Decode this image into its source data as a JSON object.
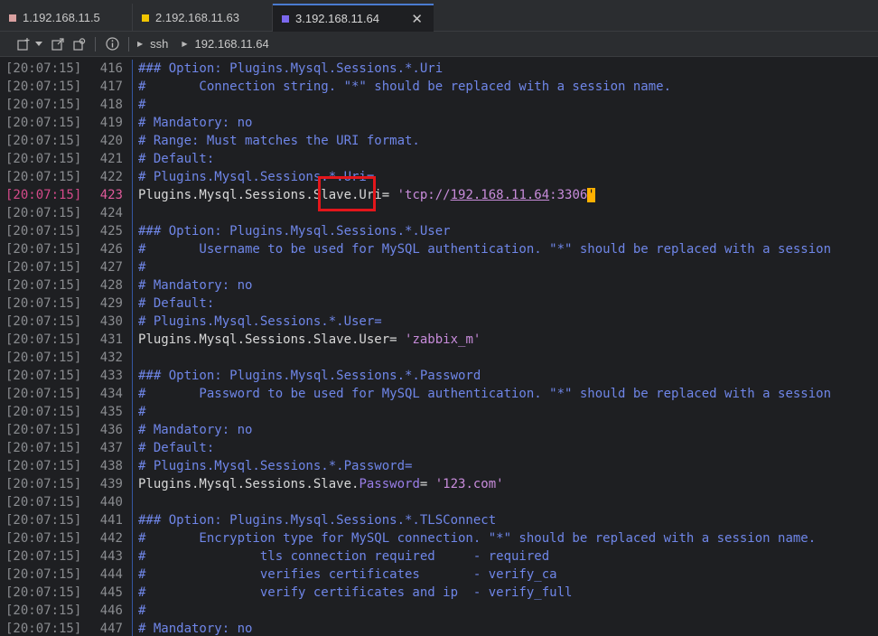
{
  "tabs": [
    {
      "label": "1.192.168.11.5",
      "color": "#d9a0a0"
    },
    {
      "label": "2.192.168.11.63",
      "color": "#f0c400"
    },
    {
      "label": "3.192.168.11.64",
      "color": "#7b68ee"
    }
  ],
  "close_glyph": "✕",
  "toolbar": {
    "breadcrumb": [
      "ssh",
      "192.168.11.64"
    ],
    "icons": [
      "new-tab-icon",
      "chevron-down-icon",
      "new-window-icon",
      "duplicate-icon",
      "info-icon"
    ]
  },
  "lines": [
    {
      "ts": "[20:07:15]",
      "n": "416",
      "t": "### Option: Plugins.Mysql.Sessions.*.Uri"
    },
    {
      "ts": "[20:07:15]",
      "n": "417",
      "t": "#       Connection string. \"*\" should be replaced with a session name."
    },
    {
      "ts": "[20:07:15]",
      "n": "418",
      "t": "#"
    },
    {
      "ts": "[20:07:15]",
      "n": "419",
      "t": "# Mandatory: no"
    },
    {
      "ts": "[20:07:15]",
      "n": "420",
      "t": "# Range: Must matches the URI format."
    },
    {
      "ts": "[20:07:15]",
      "n": "421",
      "t": "# Default:"
    },
    {
      "ts": "[20:07:15]",
      "n": "422",
      "t": "# Plugins.Mysql.Sessions.*.Uri="
    },
    {
      "ts": "[20:07:15]",
      "n": "423",
      "t": ""
    },
    {
      "ts": "[20:07:15]",
      "n": "424",
      "t": ""
    },
    {
      "ts": "[20:07:15]",
      "n": "425",
      "t": "### Option: Plugins.Mysql.Sessions.*.User"
    },
    {
      "ts": "[20:07:15]",
      "n": "426",
      "t": "#       Username to be used for MySQL authentication. \"*\" should be replaced with a session"
    },
    {
      "ts": "[20:07:15]",
      "n": "427",
      "t": "#"
    },
    {
      "ts": "[20:07:15]",
      "n": "428",
      "t": "# Mandatory: no"
    },
    {
      "ts": "[20:07:15]",
      "n": "429",
      "t": "# Default:"
    },
    {
      "ts": "[20:07:15]",
      "n": "430",
      "t": "# Plugins.Mysql.Sessions.*.User="
    },
    {
      "ts": "[20:07:15]",
      "n": "431",
      "t": ""
    },
    {
      "ts": "[20:07:15]",
      "n": "432",
      "t": ""
    },
    {
      "ts": "[20:07:15]",
      "n": "433",
      "t": "### Option: Plugins.Mysql.Sessions.*.Password"
    },
    {
      "ts": "[20:07:15]",
      "n": "434",
      "t": "#       Password to be used for MySQL authentication. \"*\" should be replaced with a session"
    },
    {
      "ts": "[20:07:15]",
      "n": "435",
      "t": "#"
    },
    {
      "ts": "[20:07:15]",
      "n": "436",
      "t": "# Mandatory: no"
    },
    {
      "ts": "[20:07:15]",
      "n": "437",
      "t": "# Default:"
    },
    {
      "ts": "[20:07:15]",
      "n": "438",
      "t": "# Plugins.Mysql.Sessions.*.Password="
    },
    {
      "ts": "[20:07:15]",
      "n": "439",
      "t": ""
    },
    {
      "ts": "[20:07:15]",
      "n": "440",
      "t": ""
    },
    {
      "ts": "[20:07:15]",
      "n": "441",
      "t": "### Option: Plugins.Mysql.Sessions.*.TLSConnect"
    },
    {
      "ts": "[20:07:15]",
      "n": "442",
      "t": "#       Encryption type for MySQL connection. \"*\" should be replaced with a session name."
    },
    {
      "ts": "[20:07:15]",
      "n": "443",
      "t": "#               tls connection required     - required"
    },
    {
      "ts": "[20:07:15]",
      "n": "444",
      "t": "#               verifies certificates       - verify_ca"
    },
    {
      "ts": "[20:07:15]",
      "n": "445",
      "t": "#               verify certificates and ip  - verify_full"
    },
    {
      "ts": "[20:07:15]",
      "n": "446",
      "t": "#"
    },
    {
      "ts": "[20:07:15]",
      "n": "447",
      "t": "# Mandatory: no"
    }
  ],
  "uri_line": {
    "key": "Plugins.Mysql.Sessions.Slave.Uri",
    "eq": "= ",
    "q1": "'",
    "pre": "tcp://",
    "ip": "192.168.11.64",
    "port": ":3306",
    "q2": "'"
  },
  "user_line": {
    "key": "Plugins.Mysql.Sessions.Slave.User",
    "eq": "= ",
    "val": "'zabbix_m'"
  },
  "password_line": {
    "key": "Plugins.Mysql.Sessions.Slave.",
    "key2": "Password",
    "eq": "= ",
    "val": "'123.com'"
  },
  "highlight_line": "423"
}
